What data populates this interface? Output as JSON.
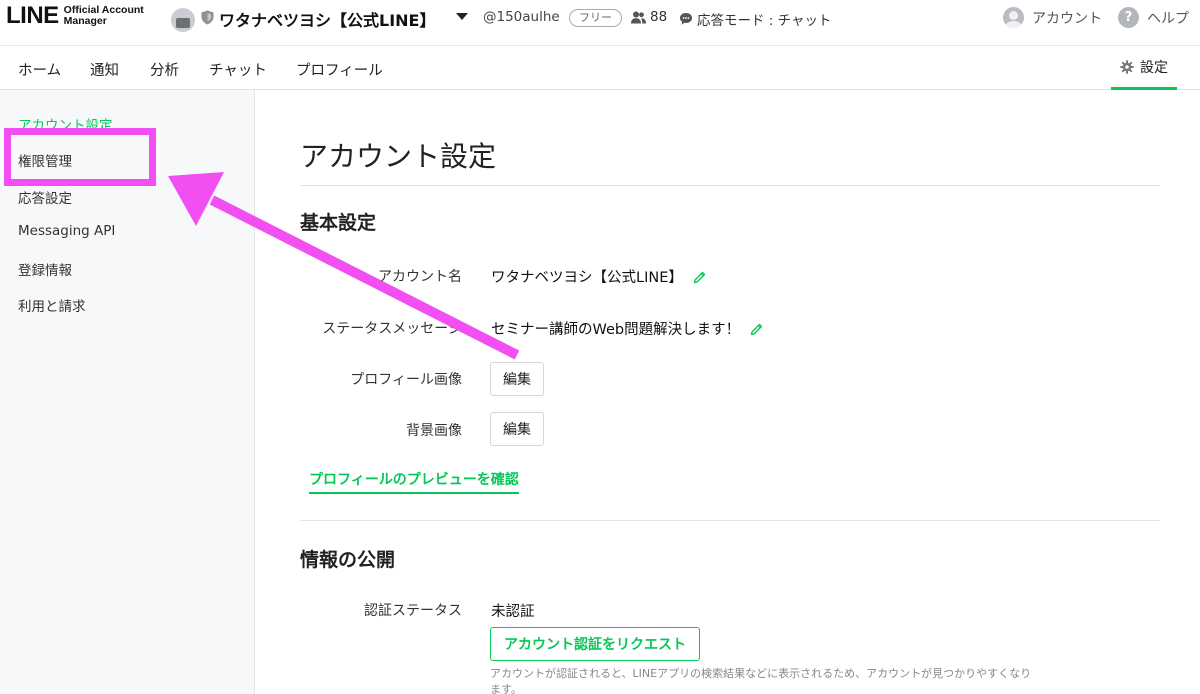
{
  "header": {
    "logo_main": "LINE",
    "logo_sub": "Official Account Manager",
    "account_name": "ワタナベツヨシ【公式LINE】",
    "account_id": "@150aulhe",
    "plan_badge": "フリー",
    "friends_count": "88",
    "response_mode": "応答モード : チャット",
    "account_link": "アカウント",
    "help_link": "ヘルプ"
  },
  "nav": {
    "items": [
      "ホーム",
      "通知",
      "分析",
      "チャット",
      "プロフィール"
    ],
    "settings_label": "設定",
    "accent_color": "#06c755"
  },
  "sidebar": {
    "items": [
      {
        "label": "アカウント設定",
        "active": true
      },
      {
        "label": "権限管理",
        "active": false
      },
      {
        "label": "応答設定",
        "active": false
      },
      {
        "label": "Messaging API",
        "active": false
      },
      {
        "label": "登録情報",
        "active": false
      },
      {
        "label": "利用と請求",
        "active": false
      }
    ]
  },
  "main": {
    "title": "アカウント設定",
    "basic_section": {
      "title": "基本設定",
      "account_name_label": "アカウント名",
      "account_name_value": "ワタナベツヨシ【公式LINE】",
      "status_message_label": "ステータスメッセージ",
      "status_message_value": "セミナー講師のWeb問題解決します！",
      "profile_image_label": "プロフィール画像",
      "background_image_label": "背景画像",
      "edit_button": "編集",
      "preview_link": "プロフィールのプレビューを確認"
    },
    "publish_section": {
      "title": "情報の公開",
      "verify_status_label": "認証ステータス",
      "verify_status_value": "未認証",
      "verify_button": "アカウント認証をリクエスト",
      "note": "アカウントが認証されると、LINEアプリの検索結果などに表示されるため、アカウントが見つかりやすくなります。"
    }
  },
  "annotation": {
    "color": "#f14ff1",
    "highlighted_item": "権限管理"
  }
}
